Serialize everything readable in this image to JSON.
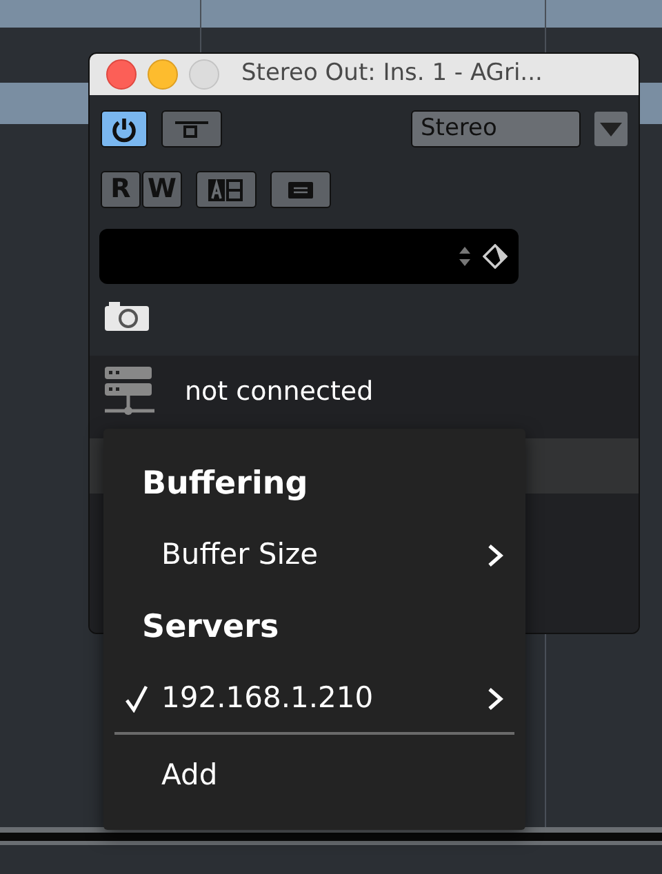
{
  "window": {
    "title": "Stereo Out: Ins. 1 - AGri..."
  },
  "toolbar": {
    "power": {
      "on": true
    },
    "bypass": {
      "on": false
    },
    "channel_select": {
      "value": "Stereo"
    }
  },
  "automation": [
    {
      "label": "R",
      "on": false
    },
    {
      "label": "W",
      "on": false
    }
  ],
  "connection": {
    "status": "not connected"
  },
  "menu": {
    "items": [
      {
        "kind": "header",
        "label": "Buffering"
      },
      {
        "kind": "item",
        "label": "Buffer Size",
        "submenu": true,
        "checked": false
      },
      {
        "kind": "header",
        "label": "Servers"
      },
      {
        "kind": "item",
        "label": "192.168.1.210",
        "submenu": true,
        "checked": true
      },
      {
        "kind": "separator"
      },
      {
        "kind": "item",
        "label": "Add",
        "submenu": false,
        "checked": false
      }
    ]
  }
}
